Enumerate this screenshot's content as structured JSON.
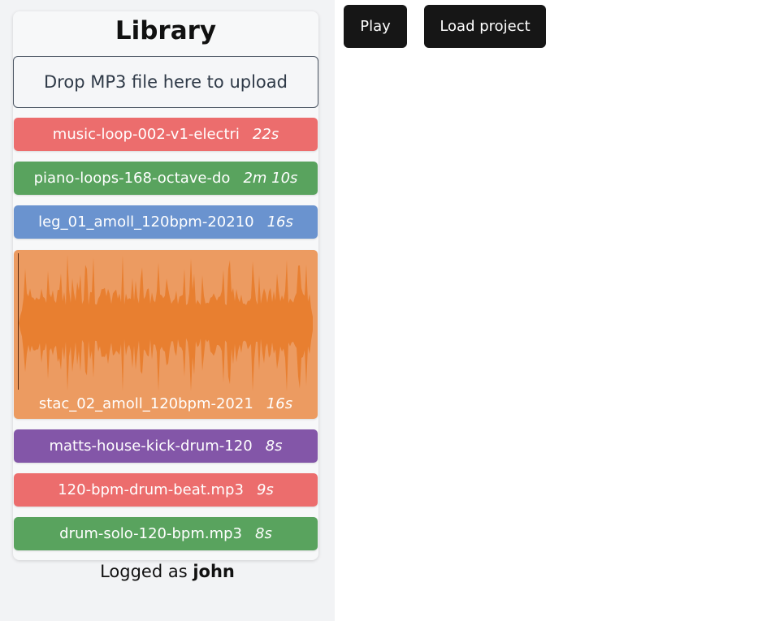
{
  "library": {
    "title": "Library",
    "dropzone_text": "Drop MP3 file here to upload",
    "tracks": [
      {
        "name": "music-loop-002-v1-electri",
        "duration": "22s",
        "color": "#ec6d6d"
      },
      {
        "name": "piano-loops-168-octave-do",
        "duration": "2m 10s",
        "color": "#59a35e"
      },
      {
        "name": "leg_01_amoll_120bpm-20210",
        "duration": "16s",
        "color": "#6a93cf"
      },
      {
        "name": "stac_02_amoll_120bpm-2021",
        "duration": "16s",
        "color": "#ec9b61",
        "waveform_color": "#e87f30",
        "expanded": true
      },
      {
        "name": "matts-house-kick-drum-120",
        "duration": "8s",
        "color": "#8356a8"
      },
      {
        "name": "120-bpm-drum-beat.mp3",
        "duration": "9s",
        "color": "#ec6d6d"
      },
      {
        "name": "drum-solo-120-bpm.mp3",
        "duration": "8s",
        "color": "#59a35e"
      }
    ]
  },
  "footer": {
    "logged_prefix": "Logged as",
    "username": "john"
  },
  "toolbar": {
    "play_label": "Play",
    "load_label": "Load project"
  }
}
